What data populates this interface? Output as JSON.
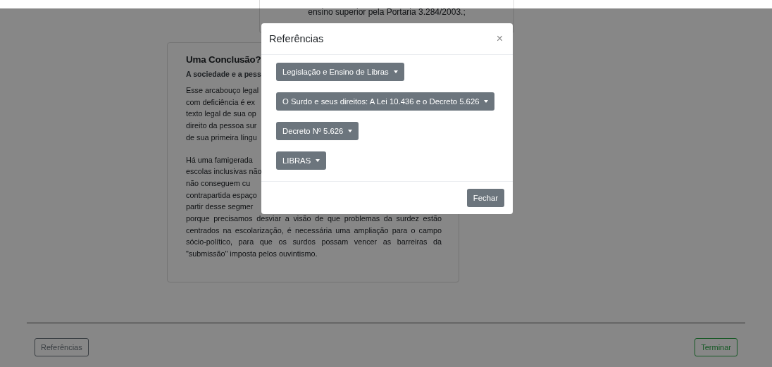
{
  "background": {
    "top_card_text": "ensino superior pela Portaria 3.284/2003.;",
    "card": {
      "title": "Uma Conclusão?",
      "subtitle": "A sociedade e a pess",
      "paragraphs": [
        [
          {
            "text": "Esse arcabouço legal",
            "kind": "cut"
          },
          {
            "text": "com deficiência é ex",
            "kind": "cut"
          },
          {
            "text": "texto legal de sua op",
            "kind": "cut"
          },
          {
            "text": "direito da pessoa sur",
            "kind": "cut"
          },
          {
            "text": "de sua primeira língu",
            "kind": "cut"
          }
        ],
        [
          {
            "text": "Há uma famigerada",
            "kind": "cut"
          },
          {
            "text": "escolas inclusivas não",
            "kind": "cut"
          },
          {
            "text": "não conseguem cu",
            "kind": "cut"
          },
          {
            "text": "contrapartida espaço",
            "kind": "cut"
          },
          {
            "text": "partir desse segmer",
            "kind": "cut"
          },
          {
            "text": "porque precisamos desviar a visão de que problemas da surdez estão",
            "kind": "full"
          },
          {
            "text": "centrados na escolarização, é necessária uma ampliação para o campo",
            "kind": "full"
          },
          {
            "text": "sócio-político, para que os surdos possam vencer as barreiras da",
            "kind": "full"
          },
          {
            "text": "\"submissão\" imposta pelos ouvintismo.",
            "kind": "end"
          }
        ]
      ]
    }
  },
  "modal": {
    "title": "Referências",
    "close": "×",
    "dropdowns": [
      "Legislação e Ensino de Libras",
      "O Surdo e seus direitos: A Lei 10.436 e o Decreto 5.626",
      "Decreto Nº 5.626",
      "LIBRAS"
    ],
    "footer_button": "Fechar"
  },
  "footer": {
    "buttons": [
      {
        "label": "Referências",
        "kind": "secondary"
      },
      {
        "label": "Terminar",
        "kind": "success"
      }
    ]
  }
}
